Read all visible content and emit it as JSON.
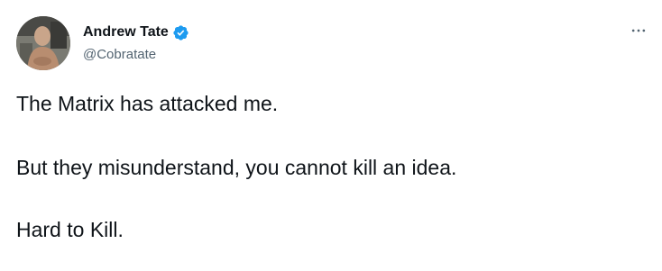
{
  "author": {
    "display_name": "Andrew Tate",
    "handle": "@Cobratate",
    "verified": true
  },
  "tweet": {
    "lines": [
      "The Matrix has attacked me.",
      "But they misunderstand, you cannot kill an idea.",
      "Hard to Kill."
    ]
  },
  "icons": {
    "verified": "verified-badge-icon",
    "more": "more-options-icon"
  },
  "colors": {
    "text": "#0f1419",
    "secondary": "#536471",
    "verified": "#1d9bf0"
  }
}
